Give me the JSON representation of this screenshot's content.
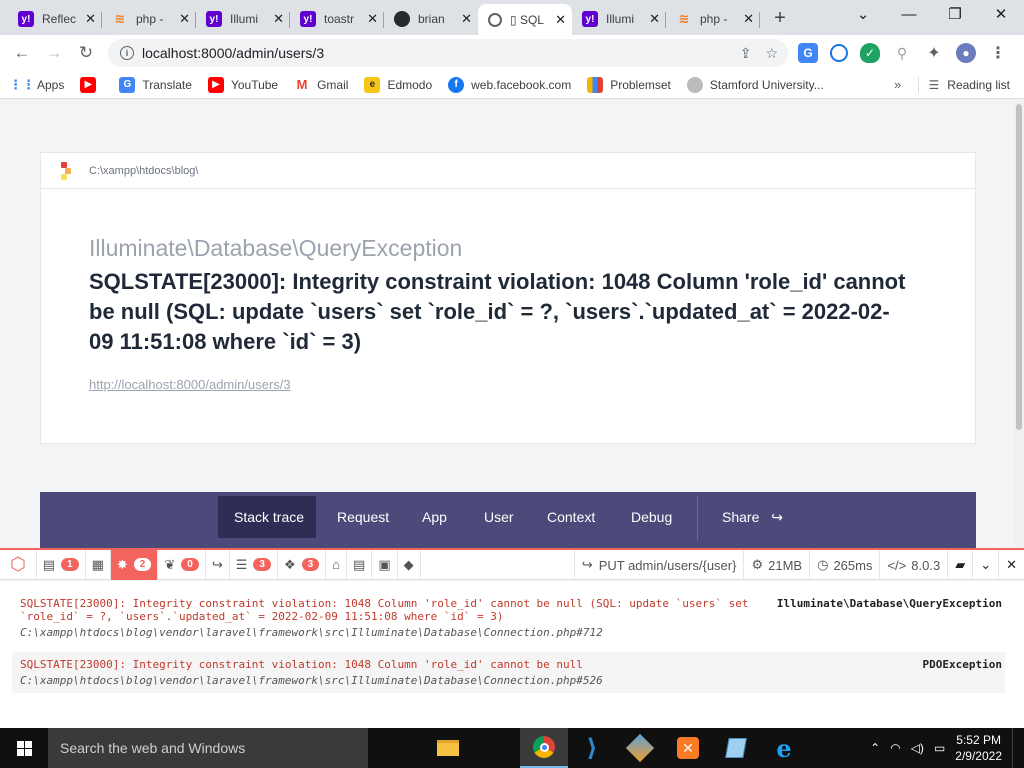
{
  "browser": {
    "tabs": [
      {
        "title": "Reflec",
        "favicon": "yahoo-icon",
        "favicon_text": "y!"
      },
      {
        "title": "php -",
        "favicon": "stackoverflow-icon",
        "favicon_text": "≋"
      },
      {
        "title": "Illumi",
        "favicon": "yahoo-icon",
        "favicon_text": "y!"
      },
      {
        "title": "toastr",
        "favicon": "yahoo-icon",
        "favicon_text": "y!"
      },
      {
        "title": "brian",
        "favicon": "github-icon",
        "favicon_text": ""
      },
      {
        "title": "▯ SQL",
        "favicon": "globe-icon",
        "favicon_text": "",
        "active": true
      },
      {
        "title": "Illumi",
        "favicon": "yahoo-icon",
        "favicon_text": "y!"
      },
      {
        "title": "php -",
        "favicon": "stackoverflow-icon",
        "favicon_text": "≋"
      }
    ],
    "new_tab": "+",
    "window_controls": {
      "dropdown": "⌄",
      "minimize": "—",
      "maximize": "❐",
      "close": "✕"
    },
    "url": "localhost:8000/admin/users/3",
    "bookmarks": [
      {
        "label": "Apps",
        "icon": "apps-grid-icon"
      },
      {
        "label": "",
        "icon": "youtube-icon"
      },
      {
        "label": "Translate",
        "icon": "translate-icon"
      },
      {
        "label": "YouTube",
        "icon": "youtube-icon"
      },
      {
        "label": "Gmail",
        "icon": "gmail-icon"
      },
      {
        "label": "Edmodo",
        "icon": "edmodo-icon"
      },
      {
        "label": "web.facebook.com",
        "icon": "facebook-icon"
      },
      {
        "label": "Problemset",
        "icon": "codeforces-icon"
      },
      {
        "label": "Stamford University...",
        "icon": "university-icon"
      }
    ],
    "bookmarks_overflow": "»",
    "reading_list": "Reading list"
  },
  "error_page": {
    "path": "C:\\xampp\\htdocs\\blog\\",
    "exception_class": "Illuminate\\Database\\QueryException",
    "message": "SQLSTATE[23000]: Integrity constraint violation: 1048 Column 'role_id' cannot be null (SQL: update `users` set `role_id` = ?, `users`.`updated_at` = 2022-02-09 11:51:08 where `id` = 3)",
    "url": "http://localhost:8000/admin/users/3",
    "tabs": [
      "Stack trace",
      "Request",
      "App",
      "User",
      "Context",
      "Debug"
    ],
    "share": "Share"
  },
  "debugbar": {
    "badges": {
      "messages": "1",
      "exceptions": "2",
      "views": "0",
      "queries": "3",
      "models": "3"
    },
    "route": "PUT admin/users/{user}",
    "memory": "21MB",
    "time": "265ms",
    "php_version": "8.0.3",
    "exceptions": [
      {
        "message": "SQLSTATE[23000]: Integrity constraint violation: 1048 Column 'role_id' cannot be null (SQL: update `users` set `role_id` = ?, `users`.`updated_at` = 2022-02-09 11:51:08 where `id` = 3)",
        "file": "C:\\xampp\\htdocs\\blog\\vendor\\laravel\\framework\\src\\Illuminate\\Database\\Connection.php#712",
        "type": "Illuminate\\Database\\QueryException"
      },
      {
        "message": "SQLSTATE[23000]: Integrity constraint violation: 1048 Column 'role_id' cannot be null",
        "file": "C:\\xampp\\htdocs\\blog\\vendor\\laravel\\framework\\src\\Illuminate\\Database\\Connection.php#526",
        "type": "PDOException"
      }
    ]
  },
  "taskbar": {
    "search_placeholder": "Search the web and Windows",
    "time": "5:52 PM",
    "date": "2/9/2022"
  },
  "colors": {
    "laravel_red": "#f4645f",
    "nav_bg": "#4b4a7a",
    "nav_active": "#2e2d55",
    "error_text": "#c0392b"
  }
}
